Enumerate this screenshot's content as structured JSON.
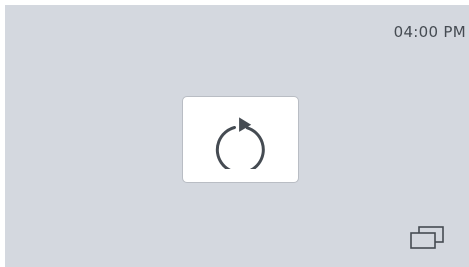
{
  "status_bar": {
    "time": "04:00 PM"
  },
  "controls": {
    "refresh_icon": "refresh-icon",
    "window_switch_icon": "window-switch-icon"
  },
  "colors": {
    "background": "#d4d8df",
    "card": "#ffffff",
    "icon": "#454b52"
  }
}
